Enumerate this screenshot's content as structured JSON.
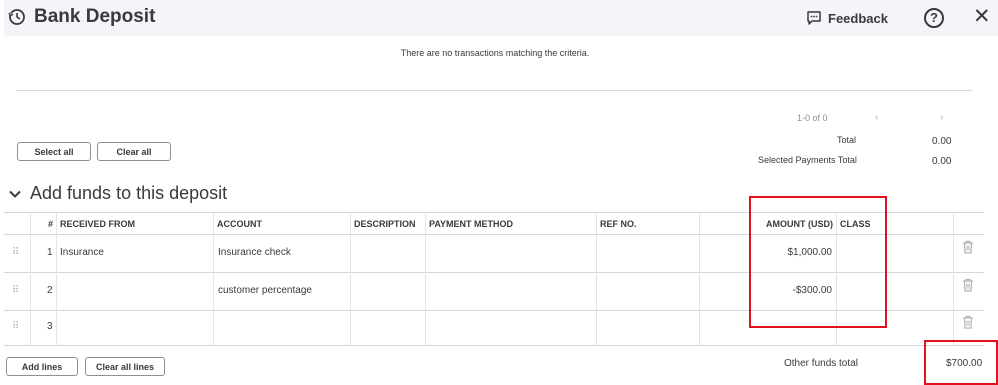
{
  "header": {
    "title": "Bank Deposit",
    "feedback_label": "Feedback",
    "help_label": "?",
    "close_label": "✕"
  },
  "transactions": {
    "empty_message": "There are no transactions matching the criteria.",
    "pager_text": "1-0 of 0",
    "prev_glyph": "‹",
    "next_glyph": "›",
    "select_all_label": "Select all",
    "clear_all_label": "Clear all",
    "total_label": "Total",
    "total_value": "0.00",
    "selected_total_label": "Selected Payments Total",
    "selected_total_value": "0.00"
  },
  "funds": {
    "section_title": "Add funds to this deposit",
    "chevron": "⌄",
    "columns": {
      "num": "#",
      "received_from": "RECEIVED FROM",
      "account": "ACCOUNT",
      "description": "DESCRIPTION",
      "payment_method": "PAYMENT METHOD",
      "ref_no": "REF NO.",
      "amount": "AMOUNT (USD)",
      "class": "CLASS"
    },
    "rows": [
      {
        "num": "1",
        "received_from": "Insurance",
        "account": "Insurance check",
        "amount": "$1,000.00"
      },
      {
        "num": "2",
        "received_from": "",
        "account": "customer percentage",
        "amount": "-$300.00"
      },
      {
        "num": "3",
        "received_from": "",
        "account": "",
        "amount": ""
      }
    ],
    "add_lines_label": "Add lines",
    "clear_all_lines_label": "Clear all lines",
    "other_funds_total_label": "Other funds total",
    "other_funds_total_value": "$700.00"
  },
  "colors": {
    "highlight": "#e3101e",
    "text": "#393a3d",
    "header_bg": "#f4f5f8"
  },
  "icons": [
    "history-icon",
    "feedback-icon",
    "help-icon",
    "close-icon",
    "drag-handle-icon",
    "trash-icon",
    "chevron-down-icon"
  ]
}
